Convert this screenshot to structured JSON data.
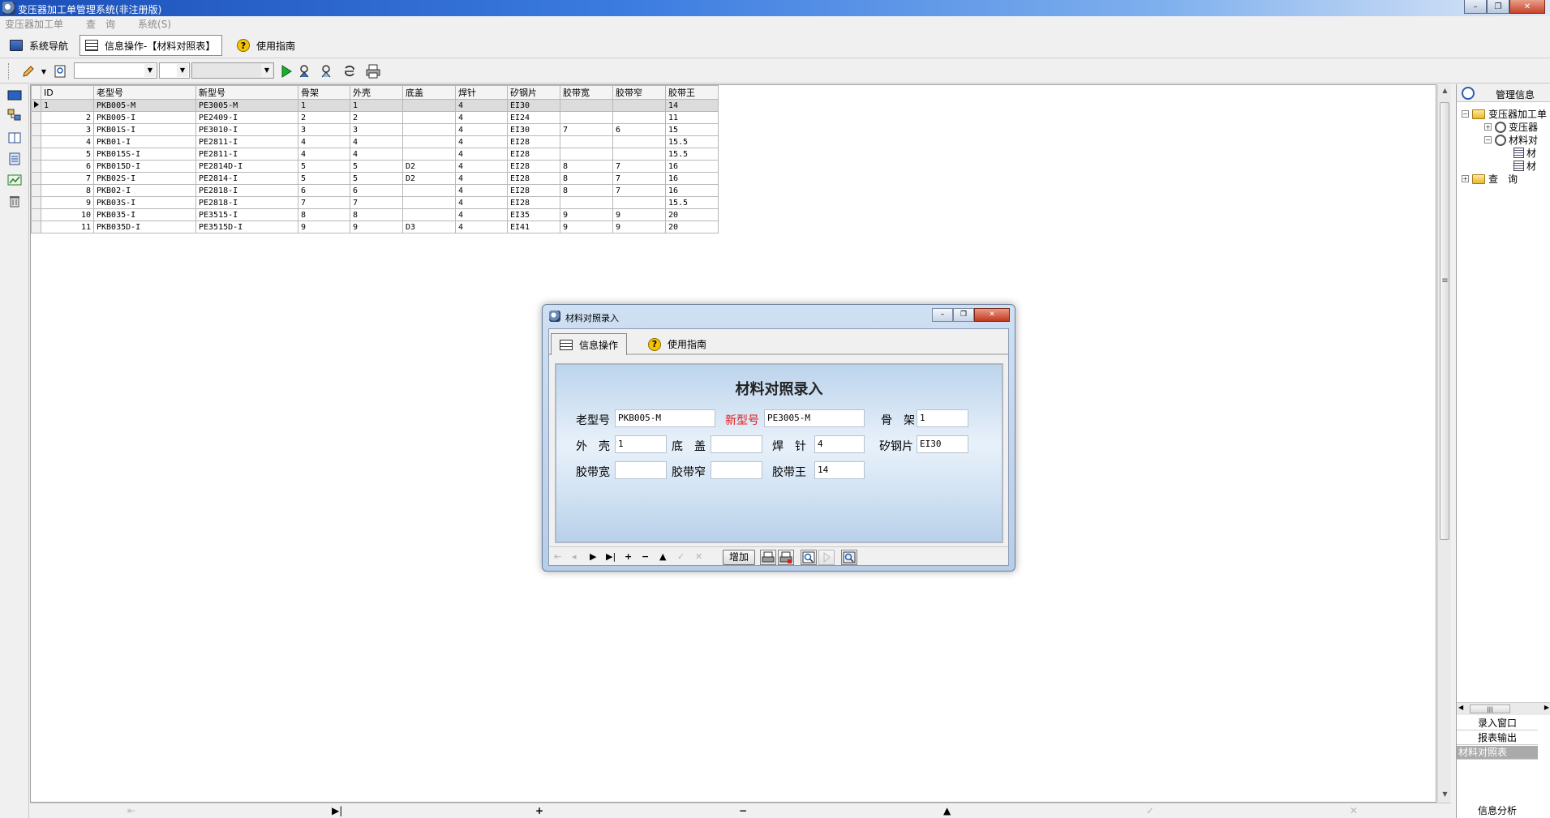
{
  "titlebar": {
    "title": "变压器加工单管理系统(非注册版)"
  },
  "menu": [
    "变压器加工单",
    "查　询",
    "系统(S)"
  ],
  "navtabs": {
    "nav": "系统导航",
    "info": "信息操作-【材料对照表】",
    "help": "使用指南"
  },
  "toolbar": {
    "combo1": "",
    "combo2": "",
    "combo3": ""
  },
  "grid": {
    "columns": [
      "ID",
      "老型号",
      "新型号",
      "骨架",
      "外壳",
      "底盖",
      "焊针",
      "矽钢片",
      "胶带宽",
      "胶带窄",
      "胶带王"
    ],
    "rows": [
      [
        "1",
        "PKB005-M",
        "PE3005-M",
        "1",
        "1",
        "",
        "4",
        "EI30",
        "",
        "",
        "14"
      ],
      [
        "2",
        "PKB005-I",
        "PE2409-I",
        "2",
        "2",
        "",
        "4",
        "EI24",
        "",
        "",
        "11"
      ],
      [
        "3",
        "PKB01S-I",
        "PE3010-I",
        "3",
        "3",
        "",
        "4",
        "EI30",
        "7",
        "6",
        "15"
      ],
      [
        "4",
        "PKB01-I",
        "PE2811-I",
        "4",
        "4",
        "",
        "4",
        "EI28",
        "",
        "",
        "15.5"
      ],
      [
        "5",
        "PKB015S-I",
        "PE2811-I",
        "4",
        "4",
        "",
        "4",
        "EI28",
        "",
        "",
        "15.5"
      ],
      [
        "6",
        "PKB015D-I",
        "PE2814D-I",
        "5",
        "5",
        "D2",
        "4",
        "EI28",
        "8",
        "7",
        "16"
      ],
      [
        "7",
        "PKB02S-I",
        "PE2814-I",
        "5",
        "5",
        "D2",
        "4",
        "EI28",
        "8",
        "7",
        "16"
      ],
      [
        "8",
        "PKB02-I",
        "PE2818-I",
        "6",
        "6",
        "",
        "4",
        "EI28",
        "8",
        "7",
        "16"
      ],
      [
        "9",
        "PKB03S-I",
        "PE2818-I",
        "7",
        "7",
        "",
        "4",
        "EI28",
        "",
        "",
        "15.5"
      ],
      [
        "10",
        "PKB035-I",
        "PE3515-I",
        "8",
        "8",
        "",
        "4",
        "EI35",
        "9",
        "9",
        "20"
      ],
      [
        "11",
        "PKB035D-I",
        "PE3515D-I",
        "9",
        "9",
        "D3",
        "4",
        "EI41",
        "9",
        "9",
        "20"
      ]
    ]
  },
  "rightpanel": {
    "header": "管理信息",
    "tree": {
      "root": "变压器加工单",
      "child1": "变压器",
      "child2": "材料对",
      "leaf1": "材",
      "leaf2": "材",
      "query": "查　询"
    },
    "tabs": [
      "录入窗口",
      "报表输出",
      "材料对照表"
    ],
    "bottom": "信息分析"
  },
  "dialog": {
    "title": "材料对照录入",
    "tab_info": "信息操作",
    "tab_help": "使用指南",
    "form_title": "材料对照录入",
    "labels": {
      "old_model": "老型号",
      "new_model": "新型号",
      "frame": "骨　架",
      "shell": "外　壳",
      "cover": "底　盖",
      "pin": "焊　针",
      "silicon": "矽钢片",
      "tape_wide": "胶带宽",
      "tape_narrow": "胶带窄",
      "tape_king": "胶带王"
    },
    "values": {
      "old_model": "PKB005-M",
      "new_model": "PE3005-M",
      "frame": "1",
      "shell": "1",
      "cover": "",
      "pin": "4",
      "silicon": "EI30",
      "tape_wide": "",
      "tape_narrow": "",
      "tape_king": "14"
    },
    "add_button": "增加"
  }
}
